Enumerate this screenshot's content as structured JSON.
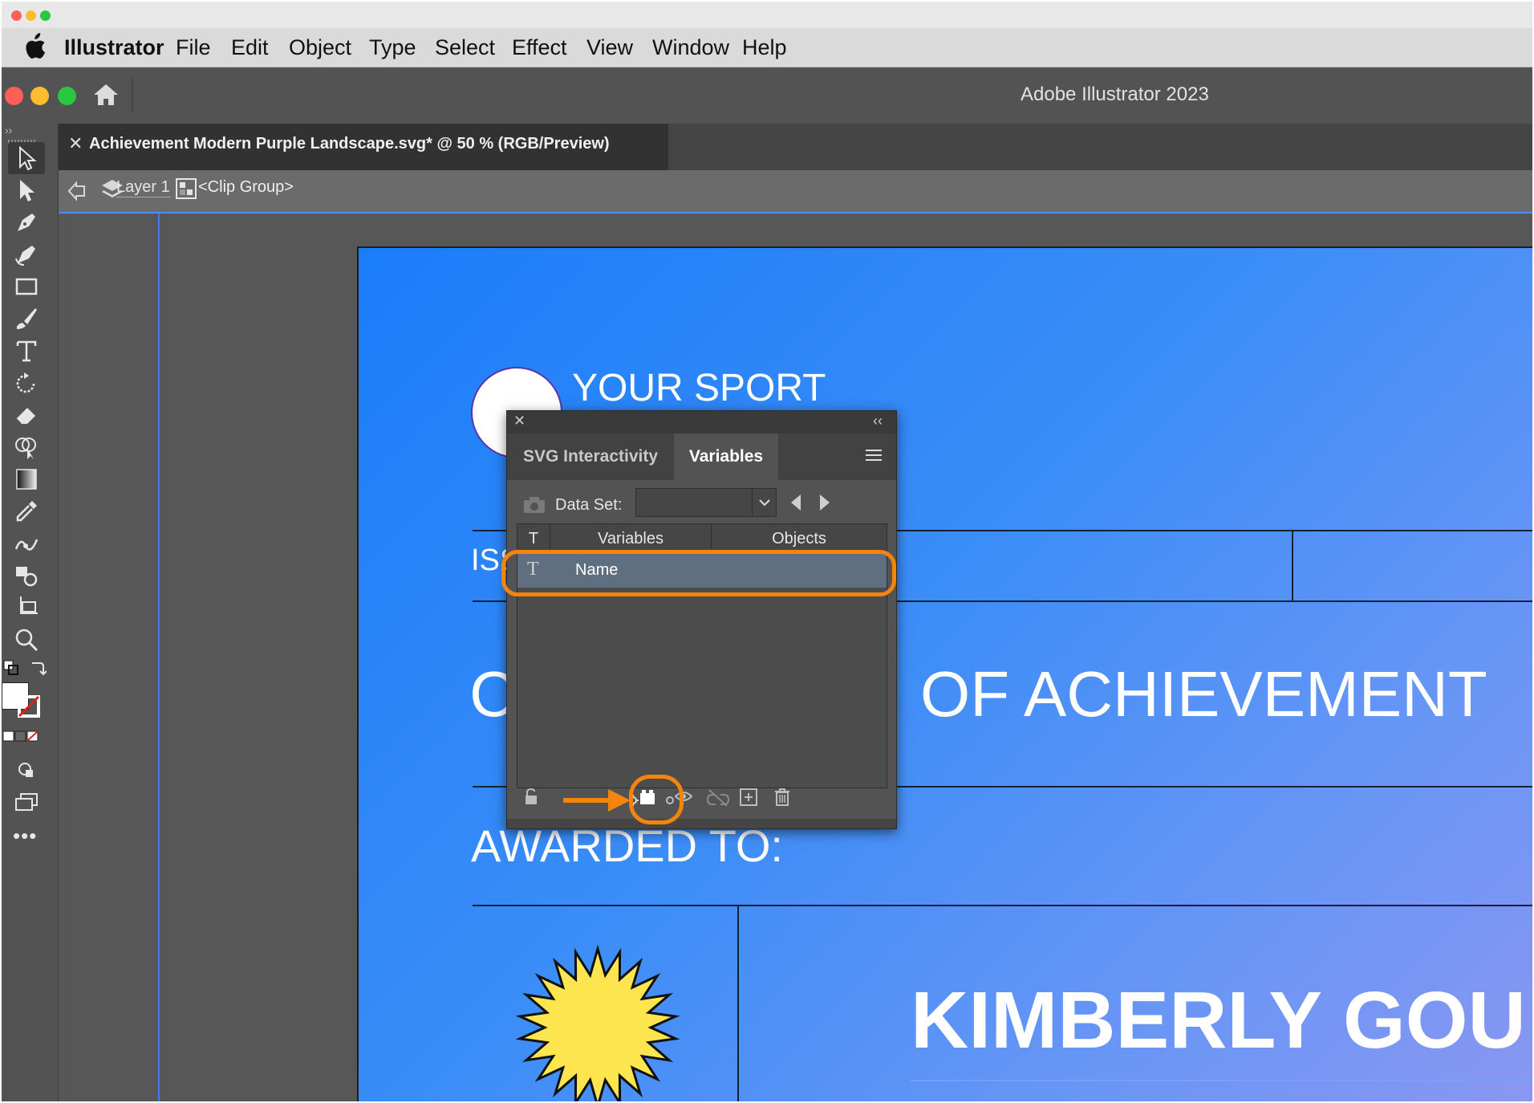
{
  "menubar": {
    "app_name": "Illustrator",
    "items": [
      "File",
      "Edit",
      "Object",
      "Type",
      "Select",
      "Effect",
      "View",
      "Window",
      "Help"
    ]
  },
  "appbar": {
    "title": "Adobe Illustrator 2023"
  },
  "document": {
    "tab_title": "Achievement Modern Purple Landscape.svg* @ 50 % (RGB/Preview)",
    "breadcrumb_layer": "Layer 1",
    "breadcrumb_group": "<Clip Group>"
  },
  "artboard": {
    "sport": "YOUR SPORT",
    "issued_partial": "ISS",
    "heading_left": "C",
    "heading_right": "OF ACHIEVEMENT",
    "awarded_to": "AWARDED TO:",
    "recipient": "KIMBERLY GOU"
  },
  "panel": {
    "tabs": [
      "SVG Interactivity",
      "Variables"
    ],
    "active_tab": "Variables",
    "data_set_label": "Data Set:",
    "columns": {
      "type": "T",
      "variables": "Variables",
      "objects": "Objects"
    },
    "rows": [
      {
        "type_glyph": "T",
        "name": "Name",
        "object": ""
      }
    ]
  },
  "colors": {
    "highlight": "#f5840c",
    "artboard_start": "#1a7dfa",
    "artboard_end": "#8a97f1",
    "selection_row": "#5f6f80",
    "canvas_bg": "#575757"
  }
}
